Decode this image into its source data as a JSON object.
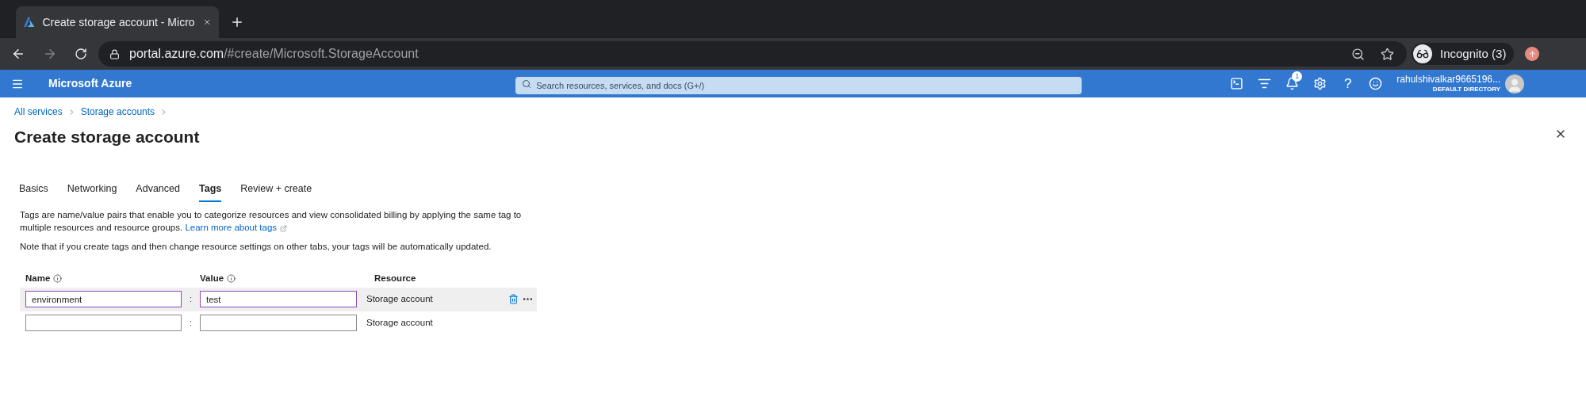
{
  "browser": {
    "tab_title": "Create storage account - Micro",
    "url_host": "portal.azure.com",
    "url_path": "/#create/Microsoft.StorageAccount",
    "profile": "Incognito (3)"
  },
  "portal": {
    "brand": "Microsoft Azure",
    "search": {
      "placeholder": "Search resources, services, and docs (G+/)"
    },
    "notifications": "1",
    "help": "?",
    "user": "rahulshivalkar9665196...",
    "directory": "DEFAULT DIRECTORY"
  },
  "breadcrumb": [
    "All services",
    "Storage accounts"
  ],
  "title": "Create storage account",
  "tabs": [
    {
      "label": "Basics",
      "selected": false
    },
    {
      "label": "Networking",
      "selected": false
    },
    {
      "label": "Advanced",
      "selected": false
    },
    {
      "label": "Tags",
      "selected": true
    },
    {
      "label": "Review + create",
      "selected": false
    }
  ],
  "description": "Tags are name/value pairs that enable you to categorize resources and view consolidated billing by applying the same tag to multiple resources and resource groups.",
  "learn_more": "Learn more about tags",
  "note": "Note that if you create tags and then change resource settings on other tabs, your tags will be automatically updated.",
  "table": {
    "columns": [
      "Name",
      "Value",
      "Resource"
    ],
    "rows": [
      {
        "name": "environment",
        "separator": ":",
        "value": "test",
        "resource": "Storage account",
        "selected": true
      },
      {
        "separator": ":",
        "resource": "Storage account",
        "selected": false
      }
    ]
  }
}
